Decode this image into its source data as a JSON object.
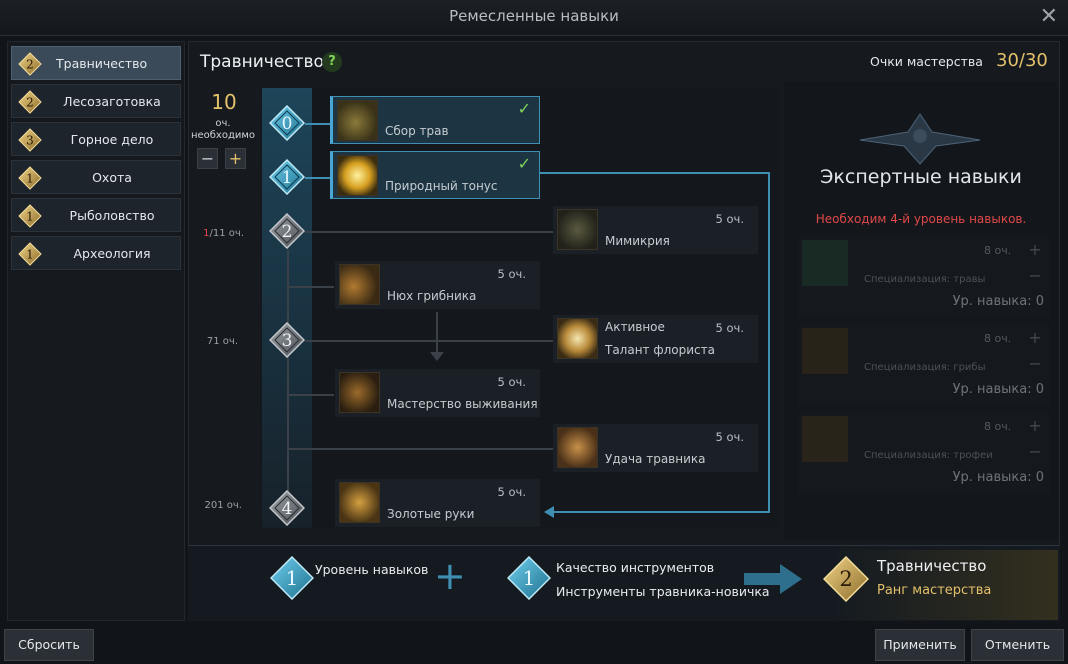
{
  "window": {
    "title": "Ремесленные навыки",
    "close_label": "✕"
  },
  "sidebar": {
    "items": [
      {
        "level": "2",
        "label": "Травничество",
        "active": true
      },
      {
        "level": "2",
        "label": "Лесозаготовка",
        "active": false
      },
      {
        "level": "3",
        "label": "Горное дело",
        "active": false
      },
      {
        "level": "1",
        "label": "Охота",
        "active": false
      },
      {
        "level": "1",
        "label": "Рыболовство",
        "active": false
      },
      {
        "level": "1",
        "label": "Археология",
        "active": false
      }
    ]
  },
  "header": {
    "title": "Травничество",
    "help": "?",
    "mastery_label": "Очки мастерства",
    "mastery_value": "30/30"
  },
  "points": {
    "required_value": "10",
    "required_label": "оч. необходимо",
    "minus": "−",
    "plus": "+"
  },
  "tier_notes": [
    {
      "current": "1",
      "rest": "/11 оч."
    },
    {
      "text": "71 оч."
    },
    {
      "text": "201 оч."
    }
  ],
  "nodes": [
    "0",
    "1",
    "2",
    "3",
    "4"
  ],
  "skills": [
    {
      "name": "Сбор трав",
      "cost": "",
      "unlocked": true,
      "check": "✓"
    },
    {
      "name": "Природный тонус",
      "cost": "",
      "unlocked": true,
      "check": "✓"
    },
    {
      "name": "Мимикрия",
      "cost": "5 оч.",
      "unlocked": false
    },
    {
      "name": "Нюх грибника",
      "cost": "5 оч.",
      "unlocked": false
    },
    {
      "name_line1": "Активное",
      "name": "Талант флориста",
      "cost": "5 оч.",
      "unlocked": false
    },
    {
      "name": "Мастерство выживания",
      "cost": "5 оч.",
      "unlocked": false
    },
    {
      "name": "Удача травника",
      "cost": "5 оч.",
      "unlocked": false
    },
    {
      "name": "Золотые руки",
      "cost": "5 оч.",
      "unlocked": false
    }
  ],
  "expert": {
    "title": "Экспертные навыки",
    "warning": "Необходим 4-й уровень навыков.",
    "cards": [
      {
        "cost": "8 оч.",
        "spec": "Специализация: травы",
        "level": "Ур. навыка: 0"
      },
      {
        "cost": "8 оч.",
        "spec": "Специализация: грибы",
        "level": "Ур. навыка: 0"
      },
      {
        "cost": "8 оч.",
        "spec": "Специализация: трофеи",
        "level": "Ур. навыка: 0"
      }
    ]
  },
  "summary": {
    "skill_level_value": "1",
    "skill_level_label": "Уровень навыков",
    "plus": "+",
    "tool_value": "1",
    "tool_quality_label": "Качество инструментов",
    "tool_name": "Инструменты травника-новичка",
    "result_value": "2",
    "result_title": "Травничество",
    "result_subtitle": "Ранг мастерства"
  },
  "footer": {
    "reset": "Сбросить",
    "apply": "Применить",
    "cancel": "Отменить"
  },
  "colors": {
    "gold": "#e3c06a",
    "accent_blue": "#4aa7d4",
    "warning": "#e04848",
    "check": "#7fd45a"
  }
}
